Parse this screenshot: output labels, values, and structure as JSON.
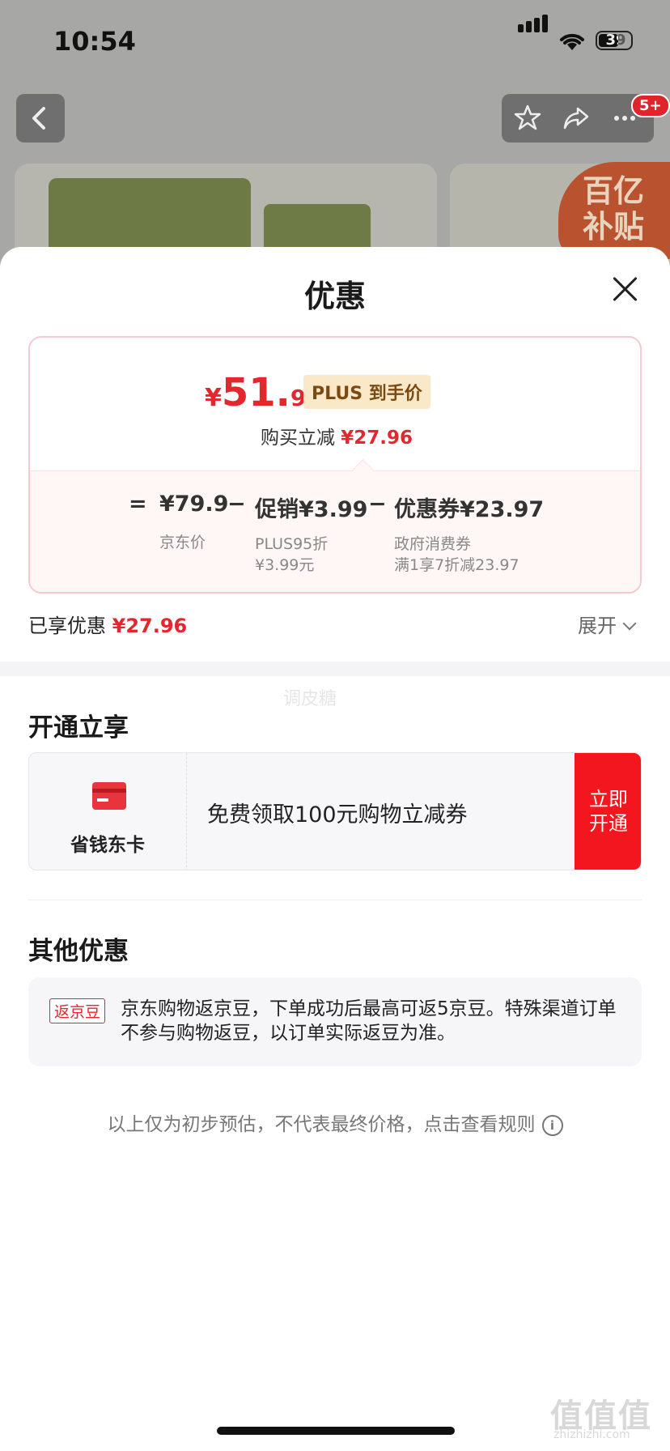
{
  "status_bar": {
    "time": "10:54",
    "battery": "39"
  },
  "nav": {
    "badge": "5+"
  },
  "subsidy_banner": {
    "line1": "百亿",
    "line2": "补贴"
  },
  "sheet": {
    "title": "优惠"
  },
  "price_card": {
    "currency": "¥",
    "price_integer": "51.",
    "price_decimal": "94",
    "plus_tag": "PLUS 到手价",
    "reduce_label": "购买立减",
    "reduce_amount": "¥27.96",
    "eq": "=",
    "jd_price": "¥79.9",
    "jd_label": "京东价",
    "minus1": "−",
    "promo": "促销¥3.99",
    "promo_note1": "PLUS95折",
    "promo_note2": "¥3.99元",
    "minus2": "−",
    "coupon": "优惠券¥23.97",
    "coupon_note1": "政府消费券",
    "coupon_note2": "满1享7折减23.97"
  },
  "enjoyed": {
    "label": "已享优惠",
    "amount": "¥27.96",
    "expand": "展开"
  },
  "watermark": "调皮糖",
  "open_section": {
    "title": "开通立享",
    "card_name": "省钱东卡",
    "desc": "免费领取100元购物立减券",
    "button_line1": "立即",
    "button_line2": "开通"
  },
  "other_section": {
    "title": "其他优惠",
    "tag": "返京豆",
    "text": "京东购物返京豆，下单成功后最高可返5京豆。特殊渠道订单不参与购物返豆，以订单实际返豆为准。"
  },
  "footnote": "以上仅为初步预估，不代表最终价格，点击查看规则",
  "site_watermark": {
    "logo": "值值值",
    "url": "zhizhizhi.com"
  },
  "colors": {
    "accent_red": "#e4262e",
    "button_red": "#f4161e",
    "plus_gold": "#fbe8c8"
  },
  "icons": [
    "back-icon",
    "star-icon",
    "share-icon",
    "more-icon",
    "close-icon",
    "chevron-down-icon",
    "card-icon",
    "info-icon"
  ]
}
